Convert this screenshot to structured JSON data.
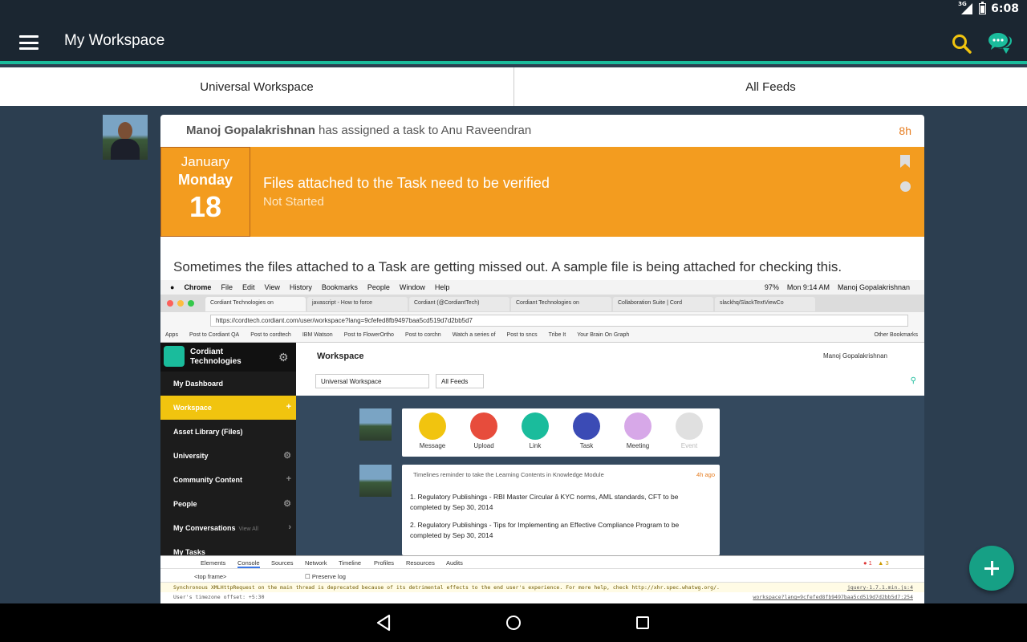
{
  "status_bar": {
    "network": "3G",
    "time": "6:08"
  },
  "app_bar": {
    "title": "My Workspace"
  },
  "tabs": [
    {
      "label": "Universal Workspace"
    },
    {
      "label": "All Feeds"
    }
  ],
  "feed": {
    "actor": "Manoj Gopalakrishnan",
    "action": "has assigned a task to",
    "assignee": "Anu Raveendran",
    "time": "8h",
    "task": {
      "month": "January",
      "weekday": "Monday",
      "day": "18",
      "title": "Files attached to the Task need to be verified",
      "status": "Not Started"
    },
    "description": "Sometimes the files attached to a Task are getting missed out. A sample file is being attached for checking this."
  },
  "attachment": {
    "mac_menu": [
      "Chrome",
      "File",
      "Edit",
      "View",
      "History",
      "Bookmarks",
      "People",
      "Window",
      "Help"
    ],
    "mac_status": {
      "battery": "97%",
      "clock": "Mon 9:14 AM",
      "user": "Manoj Gopalakrishnan"
    },
    "browser_tabs": [
      "Cordiant Technologies on",
      "javascript - How to force",
      "Cordiant (@CordiantTech)",
      "Cordiant Technologies on",
      "Collaboration Suite | Cord",
      "slackhq/SlackTextViewCo"
    ],
    "url": "https://cordtech.cordiant.com/user/workspace?lang=9cfefed8fb9497baa5cd519d7d2bb5d7",
    "bookmarks": [
      "Apps",
      "Post to Cordiant QA",
      "Post to cordtech",
      "IBM Watson",
      "Post to FlowerOrtho",
      "Post to corchn",
      "Watch a series of",
      "Post to sncs",
      "Tribe It",
      "Your Brain On Graph"
    ],
    "other_bookmarks": "Other Bookmarks",
    "brand": "Cordiant Technologies",
    "nav": [
      "My Dashboard",
      "Workspace",
      "Asset Library (Files)",
      "University",
      "Community Content",
      "People",
      "My Conversations",
      "My Tasks"
    ],
    "view_all": "View All",
    "workspace_title": "Workspace",
    "workspace_user": "Manoj Gopalakrishnan",
    "select_workspace": "Universal Workspace",
    "select_feeds": "All Feeds",
    "actions": [
      {
        "label": "Message",
        "color": "#f1c40f"
      },
      {
        "label": "Upload",
        "color": "#e74c3c"
      },
      {
        "label": "Link",
        "color": "#1abc9c"
      },
      {
        "label": "Task",
        "color": "#3b4bb5"
      },
      {
        "label": "Meeting",
        "color": "#d7a8e8"
      },
      {
        "label": "Event",
        "color": "#e0e0e0"
      }
    ],
    "timeline": {
      "header": "Timelines reminder to take the Learning Contents in Knowledge Module",
      "time": "4h ago",
      "items": [
        "1. Regulatory Publishings - RBI Master Circular â KYC norms, AML standards, CFT to be completed by Sep 30, 2014",
        "2. Regulatory Publishings - Tips for Implementing an Effective Compliance Program to be completed by Sep 30, 2014"
      ]
    },
    "devtools": {
      "tabs": [
        "Elements",
        "Console",
        "Sources",
        "Network",
        "Timeline",
        "Profiles",
        "Resources",
        "Audits"
      ],
      "frame": "<top frame>",
      "preserve_log": "Preserve log",
      "errors": "1",
      "warnings": "3",
      "warning_text": "Synchronous XMLHttpRequest on the main thread is deprecated because of its detrimental effects to the end user's experience. For more help, check http://xhr.spec.whatwg.org/.",
      "warning_source": "jquery-1.7.1.min.js:4",
      "log_text": "User's timezone offset: +5:30",
      "log_source": "workspace?lang=9cfefed8fb9497baa5cd519d7d2bb5d7:254"
    }
  },
  "colors": {
    "accent": "#1abc9c",
    "task_bg": "#f39c1f",
    "time": "#e67e22",
    "search_icon": "#f1c40f"
  }
}
